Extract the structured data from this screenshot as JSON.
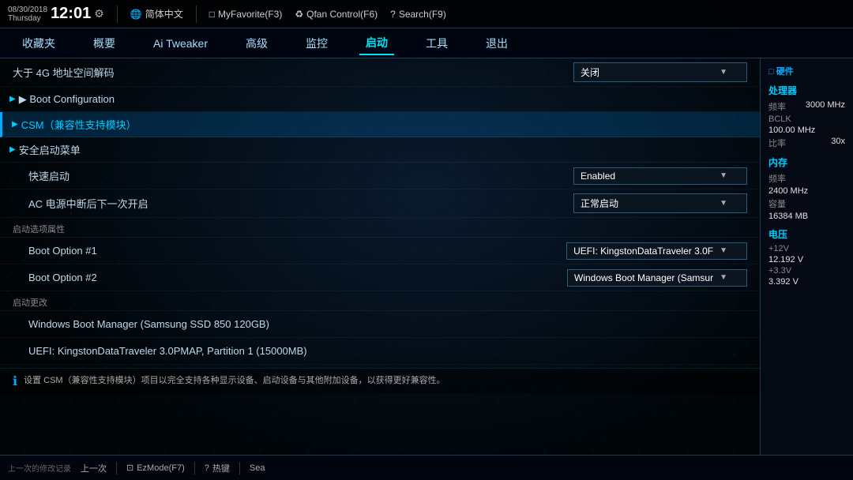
{
  "topbar": {
    "date": "08/30/2018",
    "day": "Thursday",
    "time": "12:01",
    "gear_icon": "⚙",
    "lang": "简体中文",
    "myfavorite": "MyFavorite(F3)",
    "qfan": "Qfan Control(F6)",
    "search": "Search(F9)",
    "lang_icon": "🌐",
    "myfav_icon": "□",
    "qfan_icon": "♻",
    "search_icon": "?"
  },
  "mainnav": {
    "items": [
      {
        "label": "收藏夹",
        "active": false
      },
      {
        "label": "概要",
        "active": false
      },
      {
        "label": "Ai Tweaker",
        "active": false
      },
      {
        "label": "高级",
        "active": false
      },
      {
        "label": "监控",
        "active": false
      },
      {
        "label": "启动",
        "active": true
      },
      {
        "label": "工具",
        "active": false
      },
      {
        "label": "退出",
        "active": false
      }
    ]
  },
  "hw_label": "□ 硬件",
  "settings": {
    "row1_label": "大于 4G 地址空间解码",
    "row1_value": "关闭",
    "boot_config_label": "▶ Boot Configuration",
    "csm_label": "▶ CSM（兼容性支持模块）",
    "secure_boot_label": "▶ 安全启动菜单",
    "fast_boot_label": "快速启动",
    "fast_boot_value": "Enabled",
    "ac_power_label": "AC 电源中断后下一次开启",
    "ac_power_value": "正常启动",
    "boot_options_section": "启动选项属性",
    "boot_opt1_label": "Boot Option #1",
    "boot_opt1_value": "UEFI: KingstonDataTraveler 3.0F",
    "boot_opt2_label": "Boot Option #2",
    "boot_opt2_value": "Windows Boot Manager (Samsur",
    "boot_mod_section": "启动更改",
    "boot_item1": "Windows Boot Manager (Samsung SSD 850 120GB)",
    "boot_item2": "UEFI: KingstonDataTraveler 3.0PMAP, Partition 1 (15000MB)",
    "bottom_info": "设置 CSM（兼容性支持模块）项目以完全支持各种显示设备、启动设备与其他附加设备，以获得更好兼容性。"
  },
  "sidebar": {
    "cpu_label": "处理器",
    "cpu_freq_label": "频率",
    "cpu_freq_value": "3000 MHz",
    "bclk_label": "BCLK",
    "bclk_value": "100.00 MHz",
    "ratio_label": "比率",
    "ratio_value": "30x",
    "mem_label": "内存",
    "mem_freq_label": "频率",
    "mem_freq_value": "2400 MHz",
    "mem_cap_label": "容量",
    "mem_cap_value": "16384 MB",
    "volt_label": "电压",
    "v12_label": "+12V",
    "v12_value": "12.192 V",
    "v33_label": "+3.3V",
    "v33_value": "3.392 V"
  },
  "bottombar": {
    "prev_change_label": "上一次的修改记录",
    "prev_change_value": "上一次",
    "ezmode_label": "EzMode(F7)",
    "ezmode_icon": "⊡",
    "hotkey_label": "热键",
    "hotkey_icon": "?",
    "search_label": "Sea"
  },
  "info_icon": "ℹ"
}
